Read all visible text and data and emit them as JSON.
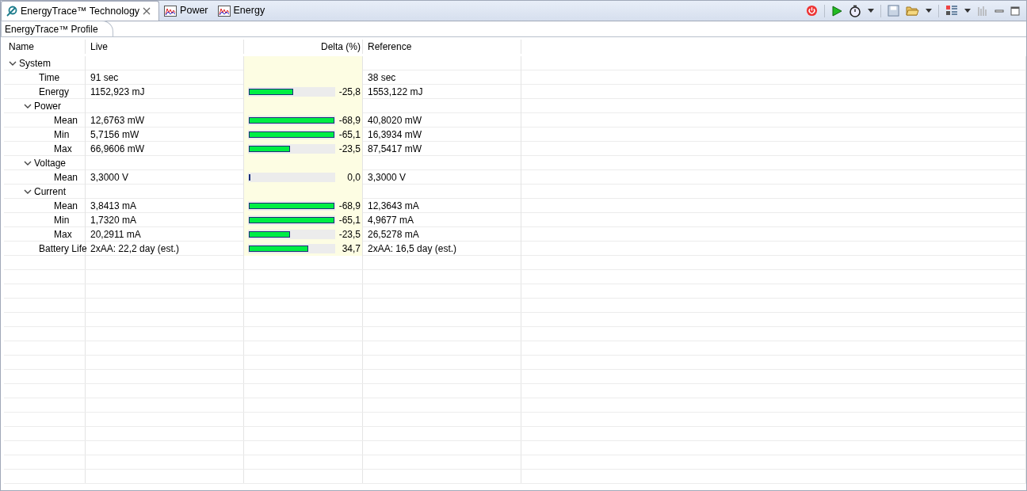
{
  "view_tabs": [
    {
      "label": "EnergyTrace™ Technology",
      "selected": true,
      "closable": true
    },
    {
      "label": "Power",
      "selected": false,
      "closable": false
    },
    {
      "label": "Energy",
      "selected": false,
      "closable": false
    }
  ],
  "sub_tabs": [
    {
      "label": "EnergyTrace™ Profile",
      "selected": true
    }
  ],
  "table": {
    "columns": [
      "Name",
      "Live",
      "Delta (%)",
      "Reference"
    ],
    "rows": [
      {
        "name": "System",
        "kind": "group",
        "expanded": true,
        "children": [
          {
            "name": "Time",
            "kind": "metric",
            "live": "91 sec",
            "reference": "38 sec"
          },
          {
            "name": "Energy",
            "kind": "metric",
            "live": "1152,923 mJ",
            "delta": {
              "level": 0.52,
              "text": "-25,8"
            },
            "reference": "1553,122 mJ"
          },
          {
            "name": "Power",
            "kind": "group",
            "expanded": true,
            "children": [
              {
                "name": "Mean",
                "kind": "metric",
                "live": "12,6763 mW",
                "delta": {
                  "level": 1.0,
                  "text": "-68,9"
                },
                "reference": "40,8020 mW"
              },
              {
                "name": "Min",
                "kind": "metric",
                "live": "5,7156 mW",
                "delta": {
                  "level": 1.0,
                  "text": "-65,1"
                },
                "reference": "16,3934 mW"
              },
              {
                "name": "Max",
                "kind": "metric",
                "live": "66,9606 mW",
                "delta": {
                  "level": 0.48,
                  "text": "-23,5"
                },
                "reference": "87,5417 mW"
              }
            ]
          },
          {
            "name": "Voltage",
            "kind": "group",
            "expanded": true,
            "children": [
              {
                "name": "Mean",
                "kind": "metric",
                "live": "3,3000 V",
                "delta": {
                  "level": 0.0,
                  "text": "0,0"
                },
                "reference": "3,3000 V"
              }
            ]
          },
          {
            "name": "Current",
            "kind": "group",
            "expanded": true,
            "children": [
              {
                "name": "Mean",
                "kind": "metric",
                "live": "3,8413 mA",
                "delta": {
                  "level": 1.0,
                  "text": "-68,9"
                },
                "reference": "12,3643 mA"
              },
              {
                "name": "Min",
                "kind": "metric",
                "live": "1,7320 mA",
                "delta": {
                  "level": 1.0,
                  "text": "-65,1"
                },
                "reference": "4,9677 mA"
              },
              {
                "name": "Max",
                "kind": "metric",
                "live": "20,2911 mA",
                "delta": {
                  "level": 0.48,
                  "text": "-23,5"
                },
                "reference": "26,5278 mA"
              }
            ]
          },
          {
            "name": "Battery Life",
            "kind": "metric",
            "live": "2xAA: 22,2 day (est.)",
            "delta": {
              "level": 0.69,
              "text": "34,7"
            },
            "reference": "2xAA: 16,5 day (est.)"
          }
        ]
      }
    ]
  }
}
